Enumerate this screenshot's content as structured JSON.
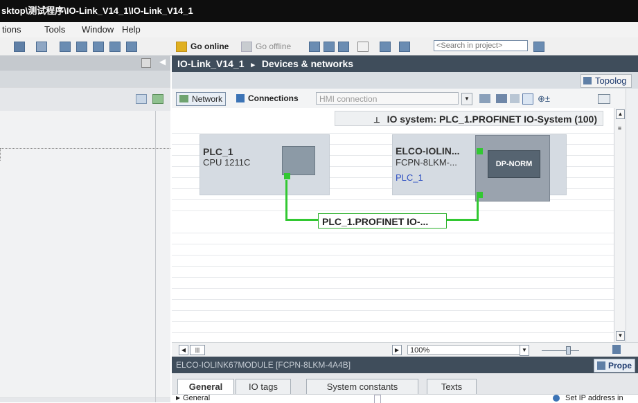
{
  "window": {
    "title": "sktop\\测试程序\\IO-Link_V14_1\\IO-Link_V14_1"
  },
  "menu": {
    "items": [
      "tions",
      "Tools",
      "Window",
      "Help"
    ]
  },
  "toolbar": {
    "go_online": "Go online",
    "go_offline": "Go offline",
    "search_placeholder": "<Search in project>"
  },
  "editor": {
    "breadcrumb_project": "IO-Link_V14_1",
    "breadcrumb_separator": "▸",
    "breadcrumb_page": "Devices & networks",
    "topology_tab": "Topolog",
    "network_button": "Network",
    "connections_button": "Connections",
    "hmi_connection": "HMI connection"
  },
  "network": {
    "io_system_label": "IO system: PLC_1.PROFINET IO-System (100)",
    "plc_name": "PLC_1",
    "plc_type": "CPU 1211C",
    "io_device_name": "ELCO-IOLIN...",
    "io_device_type": "FCPN-8LKM-...",
    "io_device_controller": "PLC_1",
    "io_device_module": "DP-NORM",
    "network_name": "PLC_1.PROFINET IO-..."
  },
  "view": {
    "zoom": "100%"
  },
  "inspector": {
    "module_title": "ELCO-IOLINK67MODULE [FCPN-8LKM-4A4B]",
    "properties_tab": "Prope",
    "tabs": [
      "General",
      "IO tags",
      "System constants",
      "Texts"
    ],
    "tree_item": "General",
    "set_ip": "Set IP address in"
  },
  "colors": {
    "header_bg": "#3f4d5b",
    "profinet_green": "#32c832",
    "device_bg": "#d5dbe2"
  }
}
